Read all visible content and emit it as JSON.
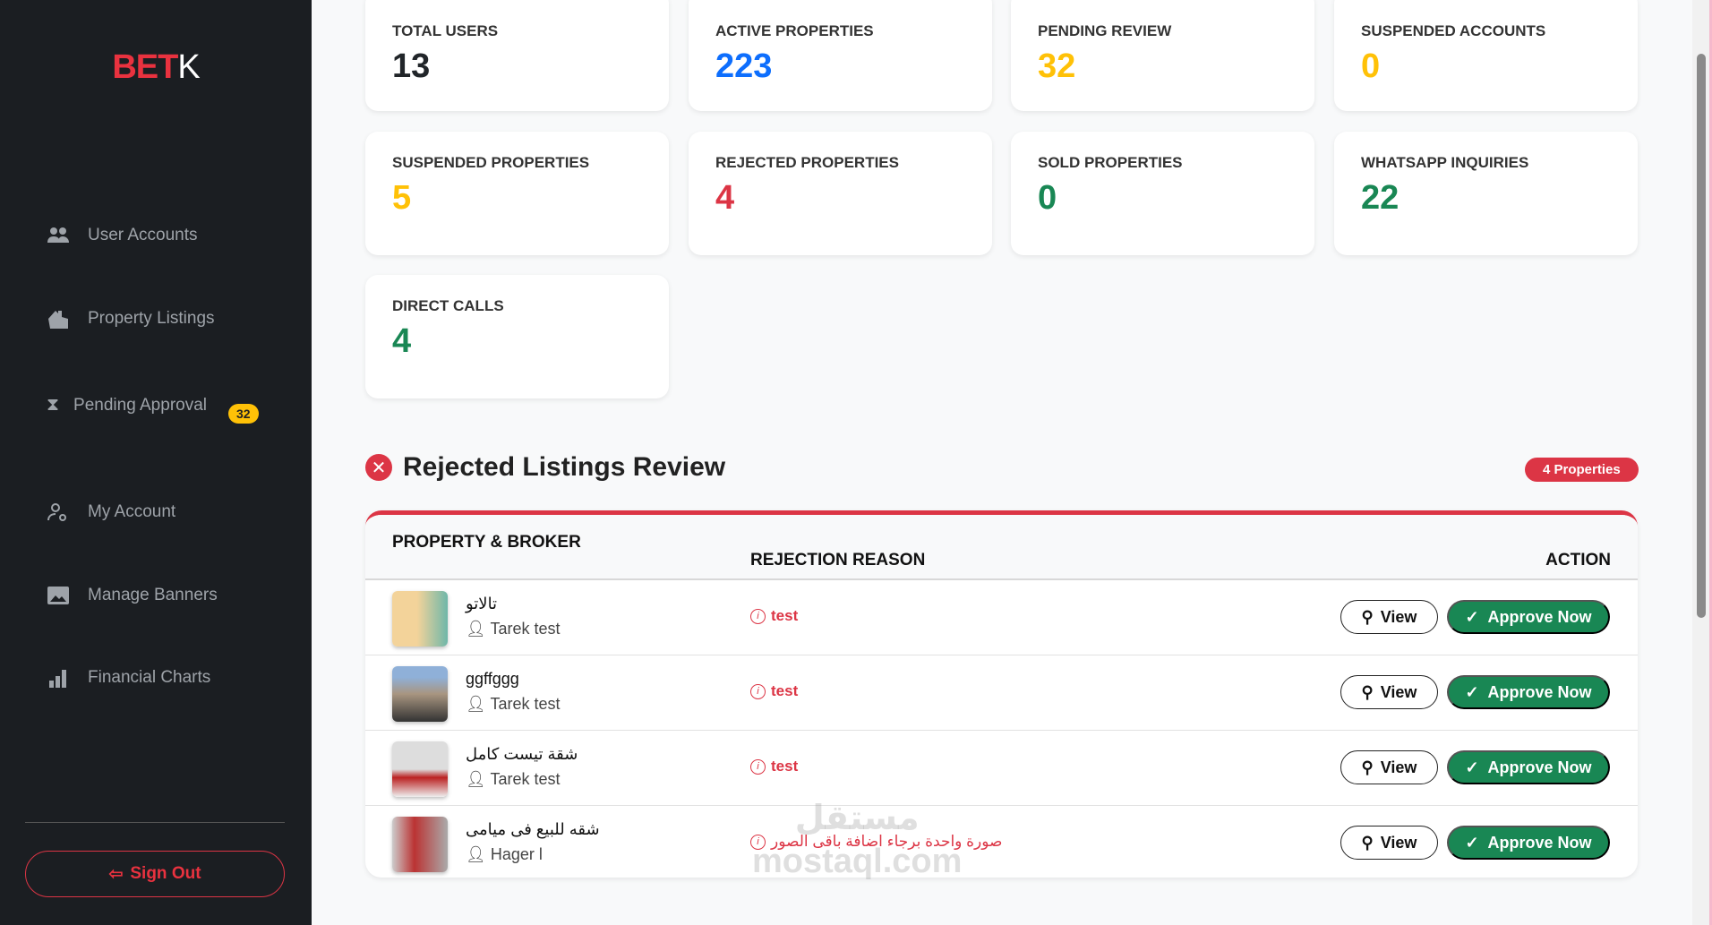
{
  "brand": {
    "part1": "BET",
    "part2": "K"
  },
  "sidebar": {
    "items": [
      {
        "label": "User Accounts",
        "icon": "users-icon"
      },
      {
        "label": "Property Listings",
        "icon": "house-icon"
      },
      {
        "label": "Pending Approval",
        "icon": "hourglass-icon",
        "badge": "32"
      },
      {
        "label": "My Account",
        "icon": "user-gear-icon"
      },
      {
        "label": "Manage Banners",
        "icon": "image-icon"
      },
      {
        "label": "Financial Charts",
        "icon": "bar-chart-icon"
      }
    ],
    "sign_out": "Sign Out"
  },
  "stats": [
    {
      "label": "TOTAL USERS",
      "value": "13",
      "color": "#212529"
    },
    {
      "label": "ACTIVE PROPERTIES",
      "value": "223",
      "color": "#0d6efd"
    },
    {
      "label": "PENDING REVIEW",
      "value": "32",
      "color": "#ffc107"
    },
    {
      "label": "SUSPENDED ACCOUNTS",
      "value": "0",
      "color": "#ffc107"
    },
    {
      "label": "SUSPENDED PROPERTIES",
      "value": "5",
      "color": "#ffc107"
    },
    {
      "label": "REJECTED PROPERTIES",
      "value": "4",
      "color": "#dc3545"
    },
    {
      "label": "SOLD PROPERTIES",
      "value": "0",
      "color": "#198754"
    },
    {
      "label": "WHATSAPP INQUIRIES",
      "value": "22",
      "color": "#198754"
    },
    {
      "label": "DIRECT CALLS",
      "value": "4",
      "color": "#198754"
    }
  ],
  "section": {
    "title": "Rejected Listings Review",
    "count": "4 Properties"
  },
  "table": {
    "headers": [
      "PROPERTY & BROKER",
      "REJECTION REASON",
      "ACTION"
    ],
    "rows": [
      {
        "title": "تالاتو",
        "broker": "Tarek test",
        "reason": "test",
        "view": "View",
        "approve": "Approve Now"
      },
      {
        "title": "ggffggg",
        "broker": "Tarek test",
        "reason": "test",
        "view": "View",
        "approve": "Approve Now"
      },
      {
        "title": "شقة تيست كامل",
        "broker": "Tarek test",
        "reason": "test",
        "view": "View",
        "approve": "Approve Now"
      },
      {
        "title": "شقه للبيع فى ميامى",
        "broker": "Hager l",
        "reason": "صورة واحدة برجاء اضافة باقى الصور",
        "view": "View",
        "approve": "Approve Now"
      }
    ]
  },
  "watermark": {
    "ar": "مستقل",
    "en": "mostaql.com"
  }
}
